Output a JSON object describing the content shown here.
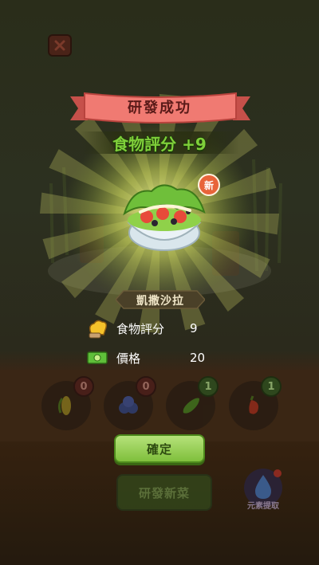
{
  "popup": {
    "title": "研發成功",
    "score_line": "食物評分 +9",
    "new_badge": "新",
    "dish_name": "凱撒沙拉",
    "stats": [
      {
        "icon": "chef-hat-icon",
        "label": "食物評分",
        "value": "9"
      },
      {
        "icon": "banknote-icon",
        "label": "價格",
        "value": "20"
      }
    ],
    "confirm_label": "確定"
  },
  "background": {
    "ingredients": [
      {
        "icon": "corn-icon",
        "count": "0"
      },
      {
        "icon": "blueberry-icon",
        "count": "0"
      },
      {
        "icon": "cucumber-icon",
        "count": "1"
      },
      {
        "icon": "chili-pepper-icon",
        "count": "1"
      }
    ],
    "develop_button_label": "研發新菜",
    "element_button_label": "元素提取"
  },
  "colors": {
    "ribbon": "#f07a72",
    "score_green": "#7fcf3a",
    "confirm_green": "#9fd45c"
  }
}
